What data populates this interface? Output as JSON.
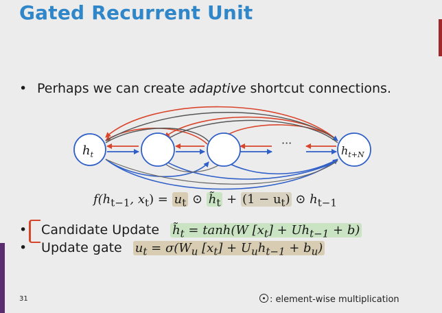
{
  "slide": {
    "title": "Gated Recurrent Unit",
    "bullet1": {
      "prefix": "Perhaps we can create ",
      "emph": "adaptive",
      "suffix": " shortcut connections."
    },
    "diagram": {
      "node_first_label": "h",
      "node_first_sub": "t",
      "node_last_label": "h",
      "node_last_sub": "t+N",
      "ellipsis": "···"
    },
    "formula": {
      "lhs": "f(h",
      "lhs_sub1": "t−1",
      "lhs_mid": ", x",
      "lhs_sub2": "t",
      "lhs_end": ") = ",
      "u": "u",
      "u_sub": "t",
      "odot1": " ⊙ ",
      "htilde": "h̃",
      "htilde_sub": "t",
      "plus": " + ",
      "one_minus": "(1 − u",
      "one_minus_sub": "t",
      "one_minus_end": ")",
      "odot2": " ⊙ h",
      "h_sub": "t−1"
    },
    "bullet2": {
      "label": "Candidate Update",
      "eq": "h̃",
      "eq_sub": "t",
      "eq_body": " = tanh(W [x",
      "eq_sub2": "t",
      "eq_body2": "] + Uh",
      "eq_sub3": "t−1",
      "eq_end": " + b)"
    },
    "bullet3": {
      "label": "Update gate",
      "eq": "u",
      "eq_sub": "t",
      "eq_body": " = σ(W",
      "eq_sub2": "u",
      "eq_body2": " [x",
      "eq_sub3": "t",
      "eq_body3": "] + U",
      "eq_sub4": "u",
      "eq_body4": "h",
      "eq_sub5": "t−1",
      "eq_body5": " + b",
      "eq_sub6": "u",
      "eq_end": ")"
    },
    "page_number": "31",
    "footnote_text": ": element-wise multiplication",
    "bullet_symbol": "•",
    "colors": {
      "title": "#2f86c8",
      "red_arrow": "#d9452b",
      "blue_arrow": "#2f5fc8",
      "node_stroke": "#2f5fc8",
      "highlight_green": "#c9e3c3",
      "highlight_tan": "#d8cdb3"
    }
  }
}
